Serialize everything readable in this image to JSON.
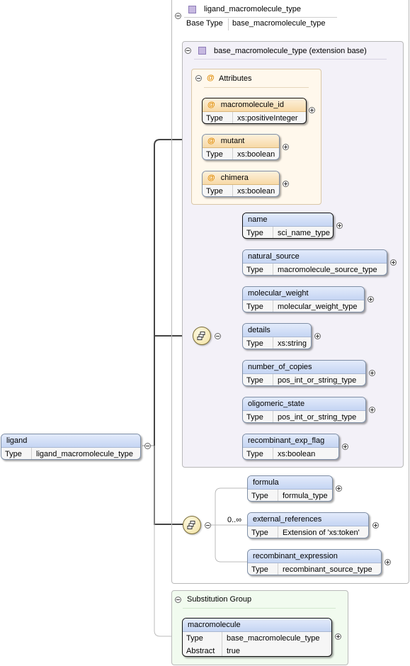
{
  "type_header": {
    "name": "ligand_macromolecule_type",
    "base_type_key": "Base Type",
    "base_type_value": "base_macromolecule_type"
  },
  "extension": {
    "title": "base_macromolecule_type (extension base)"
  },
  "attributes": {
    "title": "Attributes",
    "at_symbol": "@",
    "items": [
      {
        "name": "macromolecule_id",
        "type_key": "Type",
        "type_value": "xs:positiveInteger"
      },
      {
        "name": "mutant",
        "type_key": "Type",
        "type_value": "xs:boolean"
      },
      {
        "name": "chimera",
        "type_key": "Type",
        "type_value": "xs:boolean"
      }
    ]
  },
  "sequence_elements": [
    {
      "name": "name",
      "type_key": "Type",
      "type_value": "sci_name_type"
    },
    {
      "name": "natural_source",
      "type_key": "Type",
      "type_value": "macromolecule_source_type"
    },
    {
      "name": "molecular_weight",
      "type_key": "Type",
      "type_value": "molecular_weight_type"
    },
    {
      "name": "details",
      "type_key": "Type",
      "type_value": "xs:string"
    },
    {
      "name": "number_of_copies",
      "type_key": "Type",
      "type_value": "pos_int_or_string_type"
    },
    {
      "name": "oligomeric_state",
      "type_key": "Type",
      "type_value": "pos_int_or_string_type"
    },
    {
      "name": "recombinant_exp_flag",
      "type_key": "Type",
      "type_value": "xs:boolean"
    }
  ],
  "ligand": {
    "name": "ligand",
    "type_key": "Type",
    "type_value": "ligand_macromolecule_type"
  },
  "extension_elements": {
    "cardinality": "0..∞",
    "items": [
      {
        "name": "formula",
        "type_key": "Type",
        "type_value": "formula_type"
      },
      {
        "name": "external_references",
        "type_key": "Type",
        "type_value": "Extension of 'xs:token'"
      },
      {
        "name": "recombinant_expression",
        "type_key": "Type",
        "type_value": "recombinant_source_type"
      }
    ]
  },
  "substitution_group": {
    "title": "Substitution Group",
    "element": {
      "name": "macromolecule",
      "type_key": "Type",
      "type_value": "base_macromolecule_type",
      "abstract_key": "Abstract",
      "abstract_value": "true"
    }
  },
  "colors": {
    "element_header": "#c5d5f3",
    "attribute_header": "#f7d9a6",
    "attributes_panel": "#fff8ec",
    "extension_panel": "#f3f1f8",
    "substitution_panel": "#f1fbef"
  }
}
